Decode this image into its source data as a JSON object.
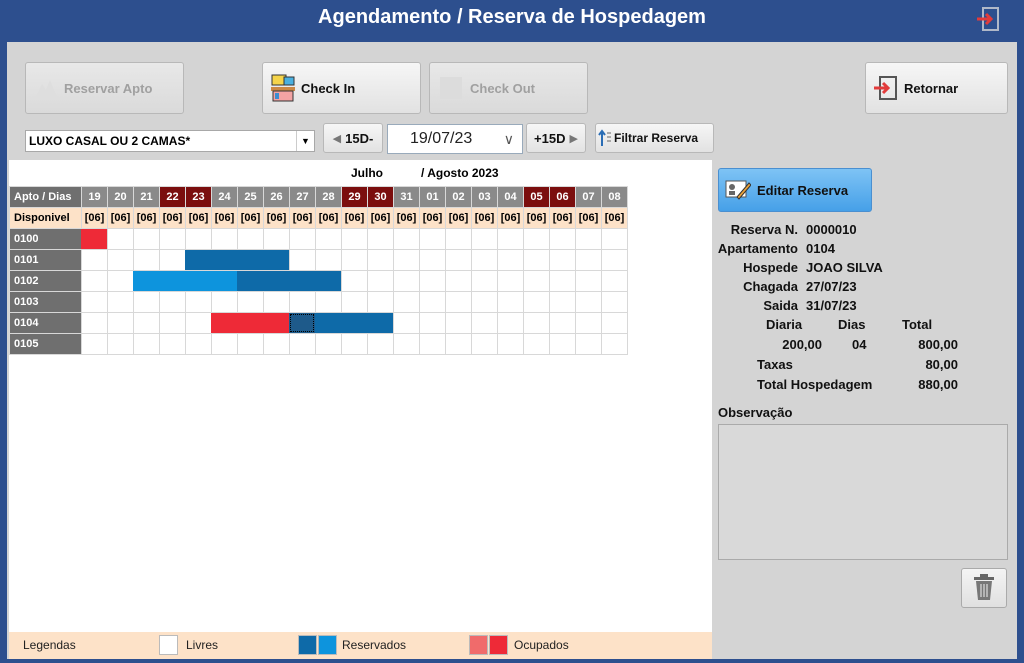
{
  "window": {
    "title": "Agendamento / Reserva de Hospedagem"
  },
  "toolbar": {
    "reservar": "Reservar Apto",
    "checkin": "Check In",
    "checkout": "Check Out",
    "retornar": "Retornar",
    "prev15": "15D-",
    "next15": "+15D",
    "filtrar": "Filtrar Reserva"
  },
  "filter": {
    "room_type": "LUXO CASAL OU 2 CAMAS*",
    "date": "19/07/23"
  },
  "calendar": {
    "month1": "Julho",
    "month2": "/ Agosto 2023",
    "corner_label": "Apto / Dias",
    "available_label": "Disponivel",
    "days": [
      "19",
      "20",
      "21",
      "22",
      "23",
      "24",
      "25",
      "26",
      "27",
      "28",
      "29",
      "30",
      "31",
      "01",
      "02",
      "03",
      "04",
      "05",
      "06",
      "07",
      "08"
    ],
    "weekend": [
      false,
      false,
      false,
      true,
      true,
      false,
      false,
      false,
      false,
      false,
      true,
      true,
      false,
      false,
      false,
      false,
      false,
      true,
      true,
      false,
      false
    ],
    "available": "[06]",
    "rooms": [
      "0100",
      "0101",
      "0102",
      "0103",
      "0104",
      "0105"
    ]
  },
  "legend": {
    "title": "Legendas",
    "free": "Livres",
    "reserved": "Reservados",
    "occupied": "Ocupados"
  },
  "colors": {
    "reserved_dark": "#0e6aa8",
    "reserved_light": "#0d94dd",
    "occupied": "#ee2a37",
    "weekend_header": "#7b0e0e"
  },
  "details": {
    "edit_button": "Editar Reserva",
    "reserva_label": "Reserva N.",
    "reserva_value": "0000010",
    "apto_label": "Apartamento",
    "apto_value": "0104",
    "hospede_label": "Hospede",
    "hospede_value": "JOAO SILVA",
    "chegada_label": "Chagada",
    "chegada_value": "27/07/23",
    "saida_label": "Saida",
    "saida_value": "31/07/23",
    "diaria_label": "Diaria",
    "dias_label": "Dias",
    "total_label": "Total",
    "diaria_value": "200,00",
    "dias_value": "04",
    "total_value": "800,00",
    "taxas_label": "Taxas",
    "taxas_value": "80,00",
    "total_hosp_label": "Total Hospedagem",
    "total_hosp_value": "880,00",
    "obs_label": "Observação"
  }
}
